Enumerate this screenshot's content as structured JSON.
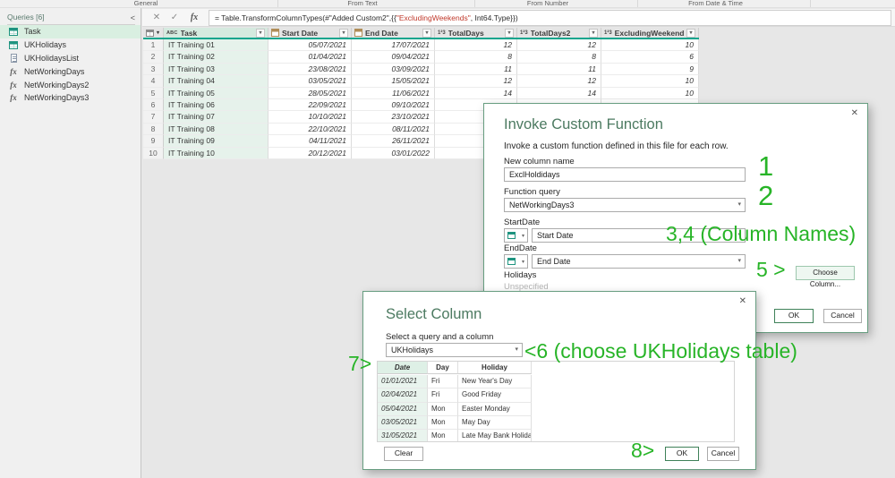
{
  "colors": {
    "annotation_green": "#27b427",
    "dialog_border_green": "#679d80",
    "title_green": "#4c7a61",
    "header_accent_teal": "#0fa58d"
  },
  "icons": {
    "close": "✕",
    "dropdown": "▾",
    "cancel_entry": "✕",
    "commit_entry": "✓",
    "fx": "fx",
    "collapse": "<",
    "abc": "ABC",
    "n123": "1²3"
  },
  "ribbon": {
    "groups": [
      "General",
      "From Text",
      "From Number",
      "From Date & Time"
    ]
  },
  "sidebar": {
    "header": "Queries [6]",
    "items": [
      {
        "label": "Task",
        "icon": "table",
        "selected": true
      },
      {
        "label": "UKHolidays",
        "icon": "table",
        "selected": false
      },
      {
        "label": "UKHolidaysList",
        "icon": "list",
        "selected": false
      },
      {
        "label": "NetWorkingDays",
        "icon": "fx",
        "selected": false
      },
      {
        "label": "NetWorkingDays2",
        "icon": "fx",
        "selected": false
      },
      {
        "label": "NetWorkingDays3",
        "icon": "fx",
        "selected": false
      }
    ]
  },
  "formula_bar": {
    "pre": "= Table.TransformColumnTypes(#\"Added Custom2\",{{",
    "str": "\"ExcludingWeekends\"",
    "post": ", Int64.Type}})"
  },
  "grid": {
    "columns": [
      {
        "name": "Task",
        "type": "abc"
      },
      {
        "name": "Start Date",
        "type": "cal"
      },
      {
        "name": "End Date",
        "type": "cal"
      },
      {
        "name": "TotalDays",
        "type": "123"
      },
      {
        "name": "TotalDays2",
        "type": "123"
      },
      {
        "name": "ExcludingWeekends",
        "type": "123"
      }
    ],
    "rows": [
      [
        "1",
        "IT Training 01",
        "05/07/2021",
        "17/07/2021",
        "12",
        "12",
        "10"
      ],
      [
        "2",
        "IT Training 02",
        "01/04/2021",
        "09/04/2021",
        "8",
        "8",
        "6"
      ],
      [
        "3",
        "IT Training 03",
        "23/08/2021",
        "03/09/2021",
        "11",
        "11",
        "9"
      ],
      [
        "4",
        "IT Training 04",
        "03/05/2021",
        "15/05/2021",
        "12",
        "12",
        "10"
      ],
      [
        "5",
        "IT Training 05",
        "28/05/2021",
        "11/06/2021",
        "14",
        "14",
        "10"
      ],
      [
        "6",
        "IT Training 06",
        "22/09/2021",
        "09/10/2021",
        "",
        "",
        ""
      ],
      [
        "7",
        "IT Training 07",
        "10/10/2021",
        "23/10/2021",
        "",
        "",
        ""
      ],
      [
        "8",
        "IT Training 08",
        "22/10/2021",
        "08/11/2021",
        "",
        "",
        ""
      ],
      [
        "9",
        "IT Training 09",
        "04/11/2021",
        "26/11/2021",
        "",
        "",
        ""
      ],
      [
        "10",
        "IT Training 10",
        "20/12/2021",
        "03/01/2022",
        "",
        "",
        ""
      ]
    ]
  },
  "invoke_dialog": {
    "title": "Invoke Custom Function",
    "subtitle": "Invoke a custom function defined in this file for each row.",
    "new_column_label": "New column name",
    "new_column_value": "ExclHoldidays",
    "function_query_label": "Function query",
    "function_query_value": "NetWorkingDays3",
    "startdate_label": "StartDate",
    "startdate_value": "Start Date",
    "enddate_label": "EndDate",
    "enddate_value": "End Date",
    "holidays_label": "Holidays",
    "holidays_value": "Unspecified",
    "choose_column": "Choose Column...",
    "ok": "OK",
    "cancel": "Cancel"
  },
  "select_dialog": {
    "title": "Select Column",
    "label": "Select a query and a column",
    "query_value": "UKHolidays",
    "table": {
      "headers": [
        "Date",
        "Day",
        "Holiday"
      ],
      "rows": [
        [
          "01/01/2021",
          "Fri",
          "New Year's Day"
        ],
        [
          "02/04/2021",
          "Fri",
          "Good Friday"
        ],
        [
          "05/04/2021",
          "Mon",
          "Easter Monday"
        ],
        [
          "03/05/2021",
          "Mon",
          "May Day"
        ],
        [
          "31/05/2021",
          "Mon",
          "Late May Bank Holiday"
        ]
      ]
    },
    "clear": "Clear",
    "ok": "OK",
    "cancel": "Cancel"
  },
  "annotations": {
    "a1": "1",
    "a2": "2",
    "a34": "3,4 (Column Names)",
    "a5": "5 >",
    "a6": "<6 (choose UKHolidays table)",
    "a7": "7>",
    "a8": "8>"
  }
}
